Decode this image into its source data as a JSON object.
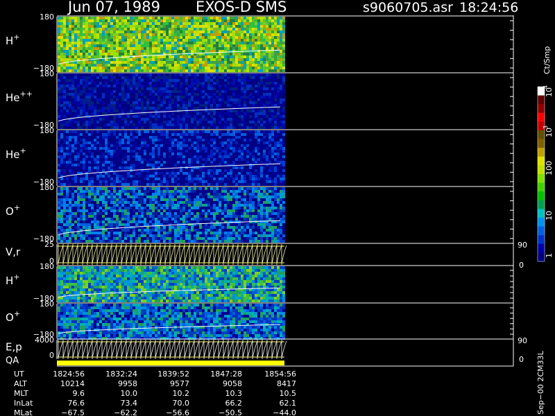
{
  "header": {
    "date": "Jun 07, 1989",
    "instrument": "EXOS-D SMS",
    "filename": "s9060705.asr",
    "time": "18:24:56"
  },
  "colorbar": {
    "unit": "Ct/Smp",
    "ticks": [
      "1",
      "10",
      "100",
      "10",
      "10",
      "3",
      "4"
    ],
    "colors": [
      "#000080",
      "#0000a8",
      "#0030c8",
      "#0060e0",
      "#0090f0",
      "#00c0c0",
      "#00a050",
      "#00c000",
      "#40d000",
      "#80e000",
      "#c0e000",
      "#e0e000",
      "#c0a000",
      "#806000",
      "#605000",
      "#c00000",
      "#ff0000",
      "#900000",
      "#600000",
      "#ffffff"
    ]
  },
  "panels": [
    {
      "id": "H+",
      "label": "H",
      "sup": "+",
      "ymax": "180",
      "ymin": "−180"
    },
    {
      "id": "He++",
      "label": "He",
      "sup": "++",
      "ymax": "180",
      "ymin": "−180"
    },
    {
      "id": "He+",
      "label": "He",
      "sup": "+",
      "ymax": "180",
      "ymin": "−180"
    },
    {
      "id": "O+",
      "label": "O",
      "sup": "+",
      "ymax": "180",
      "ymin": "−180"
    },
    {
      "id": "Vr",
      "label": "V,r",
      "sup": "",
      "ymax": "25",
      "ymin": "0",
      "rmax": "90",
      "rmin": "0"
    },
    {
      "id": "H+2",
      "label": "H",
      "sup": "+",
      "ymax": "180",
      "ymin": "−180"
    },
    {
      "id": "O+2",
      "label": "O",
      "sup": "+",
      "ymax": "180",
      "ymin": "−180"
    },
    {
      "id": "Ep",
      "label": "E,p",
      "sup": "",
      "ymax": "4000",
      "ymin": "0",
      "rmax": "90",
      "rmin": "0"
    }
  ],
  "qa_label": "QA",
  "footer": {
    "rows": [
      {
        "name": "UT",
        "values": [
          "1824:56",
          "1832:24",
          "1839:52",
          "1847:28",
          "1854:56"
        ]
      },
      {
        "name": "ALT",
        "values": [
          "10214",
          "9958",
          "9577",
          "9058",
          "8417"
        ]
      },
      {
        "name": "MLT",
        "values": [
          "9.6",
          "10.0",
          "10.2",
          "10.3",
          "10.5"
        ]
      },
      {
        "name": "InLat",
        "values": [
          "76.6",
          "73.4",
          "70.0",
          "66.2",
          "62.1"
        ]
      },
      {
        "name": "MLat",
        "values": [
          "−67.5",
          "−62.2",
          "−56.6",
          "−50.5",
          "−44.0"
        ]
      }
    ]
  },
  "side_text": "Sep−00 2CM33L",
  "chart_data": {
    "type": "heatmap",
    "title": "Jun 07, 1989   EXOS-D SMS",
    "x": [
      "1824:56",
      "1832:24",
      "1839:52",
      "1847:28",
      "1854:56"
    ],
    "series": [
      {
        "name": "H+",
        "ylim": [
          -180,
          180
        ]
      },
      {
        "name": "He++",
        "ylim": [
          -180,
          180
        ]
      },
      {
        "name": "He+",
        "ylim": [
          -180,
          180
        ]
      },
      {
        "name": "O+",
        "ylim": [
          -180,
          180
        ]
      },
      {
        "name": "V,r",
        "ylim": [
          0,
          25
        ]
      },
      {
        "name": "H+",
        "ylim": [
          -180,
          180
        ]
      },
      {
        "name": "O+",
        "ylim": [
          -180,
          180
        ]
      },
      {
        "name": "E,p",
        "ylim": [
          0,
          4000
        ]
      }
    ],
    "colorscale": {
      "label": "Ct/Smp",
      "range": [
        1,
        10000
      ],
      "scale": "log"
    }
  }
}
